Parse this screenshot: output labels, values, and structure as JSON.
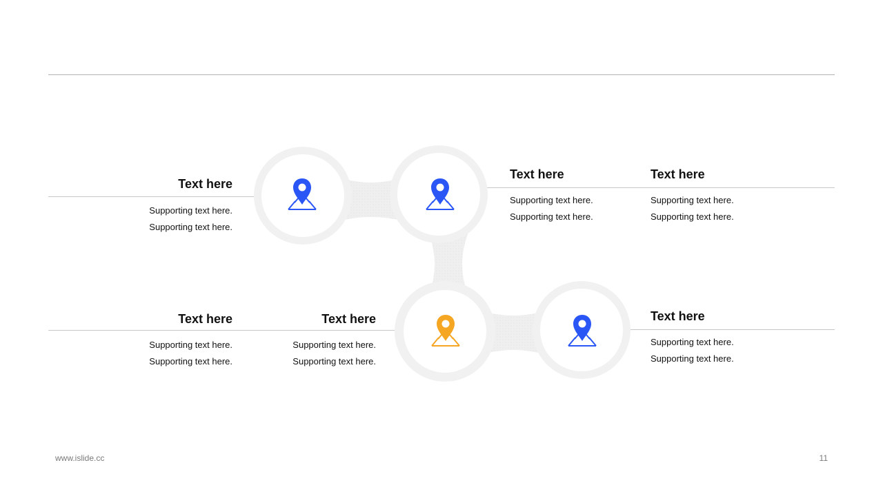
{
  "colors": {
    "accent_blue": "#2a56f6",
    "accent_orange": "#f5a623",
    "ring_gray": "#f1f1f1"
  },
  "nodes": [
    {
      "icon": "map-pin-icon",
      "color": "#2a56f6"
    },
    {
      "icon": "map-pin-icon",
      "color": "#2a56f6"
    },
    {
      "icon": "map-pin-icon",
      "color": "#f5a623"
    },
    {
      "icon": "map-pin-icon",
      "color": "#2a56f6"
    }
  ],
  "blocks": [
    {
      "title": "Text here",
      "line1": "Supporting  text here.",
      "line2": "Supporting  text here."
    },
    {
      "title": "Text here",
      "line1": "Supporting  text here.",
      "line2": "Supporting  text here."
    },
    {
      "title": "Text here",
      "line1": "Supporting  text here.",
      "line2": "Supporting  text here."
    },
    {
      "title": "Text here",
      "line1": "Supporting  text here.",
      "line2": "Supporting  text here."
    },
    {
      "title": "Text here",
      "line1": "Supporting  text here.",
      "line2": "Supporting  text here."
    },
    {
      "title": "Text here",
      "line1": "Supporting  text here.",
      "line2": "Supporting  text here."
    }
  ],
  "footer": {
    "url": "www.islide.cc",
    "page": "11"
  }
}
